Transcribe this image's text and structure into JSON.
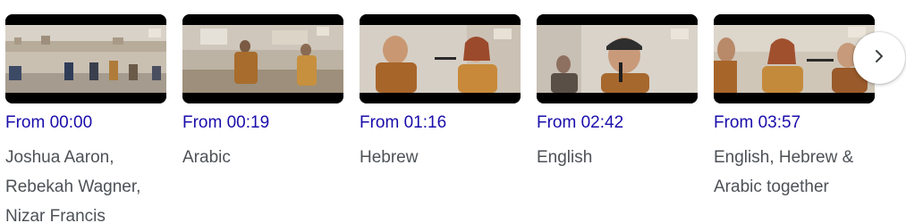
{
  "cards": [
    {
      "time": "From 00:00",
      "caption_lines": [
        "Joshua Aaron,",
        "Rebekah Wagner,",
        "Nizar Francis"
      ]
    },
    {
      "time": "From 00:19",
      "caption_lines": [
        "Arabic"
      ]
    },
    {
      "time": "From 01:16",
      "caption_lines": [
        "Hebrew"
      ]
    },
    {
      "time": "From 02:42",
      "caption_lines": [
        "English"
      ]
    },
    {
      "time": "From 03:57",
      "caption_lines": [
        "English, Hebrew &",
        "Arabic together"
      ]
    }
  ],
  "next_button": {
    "icon": "chevron-right-icon"
  },
  "colors": {
    "link": "#1a0dab",
    "caption": "#4d5156"
  }
}
